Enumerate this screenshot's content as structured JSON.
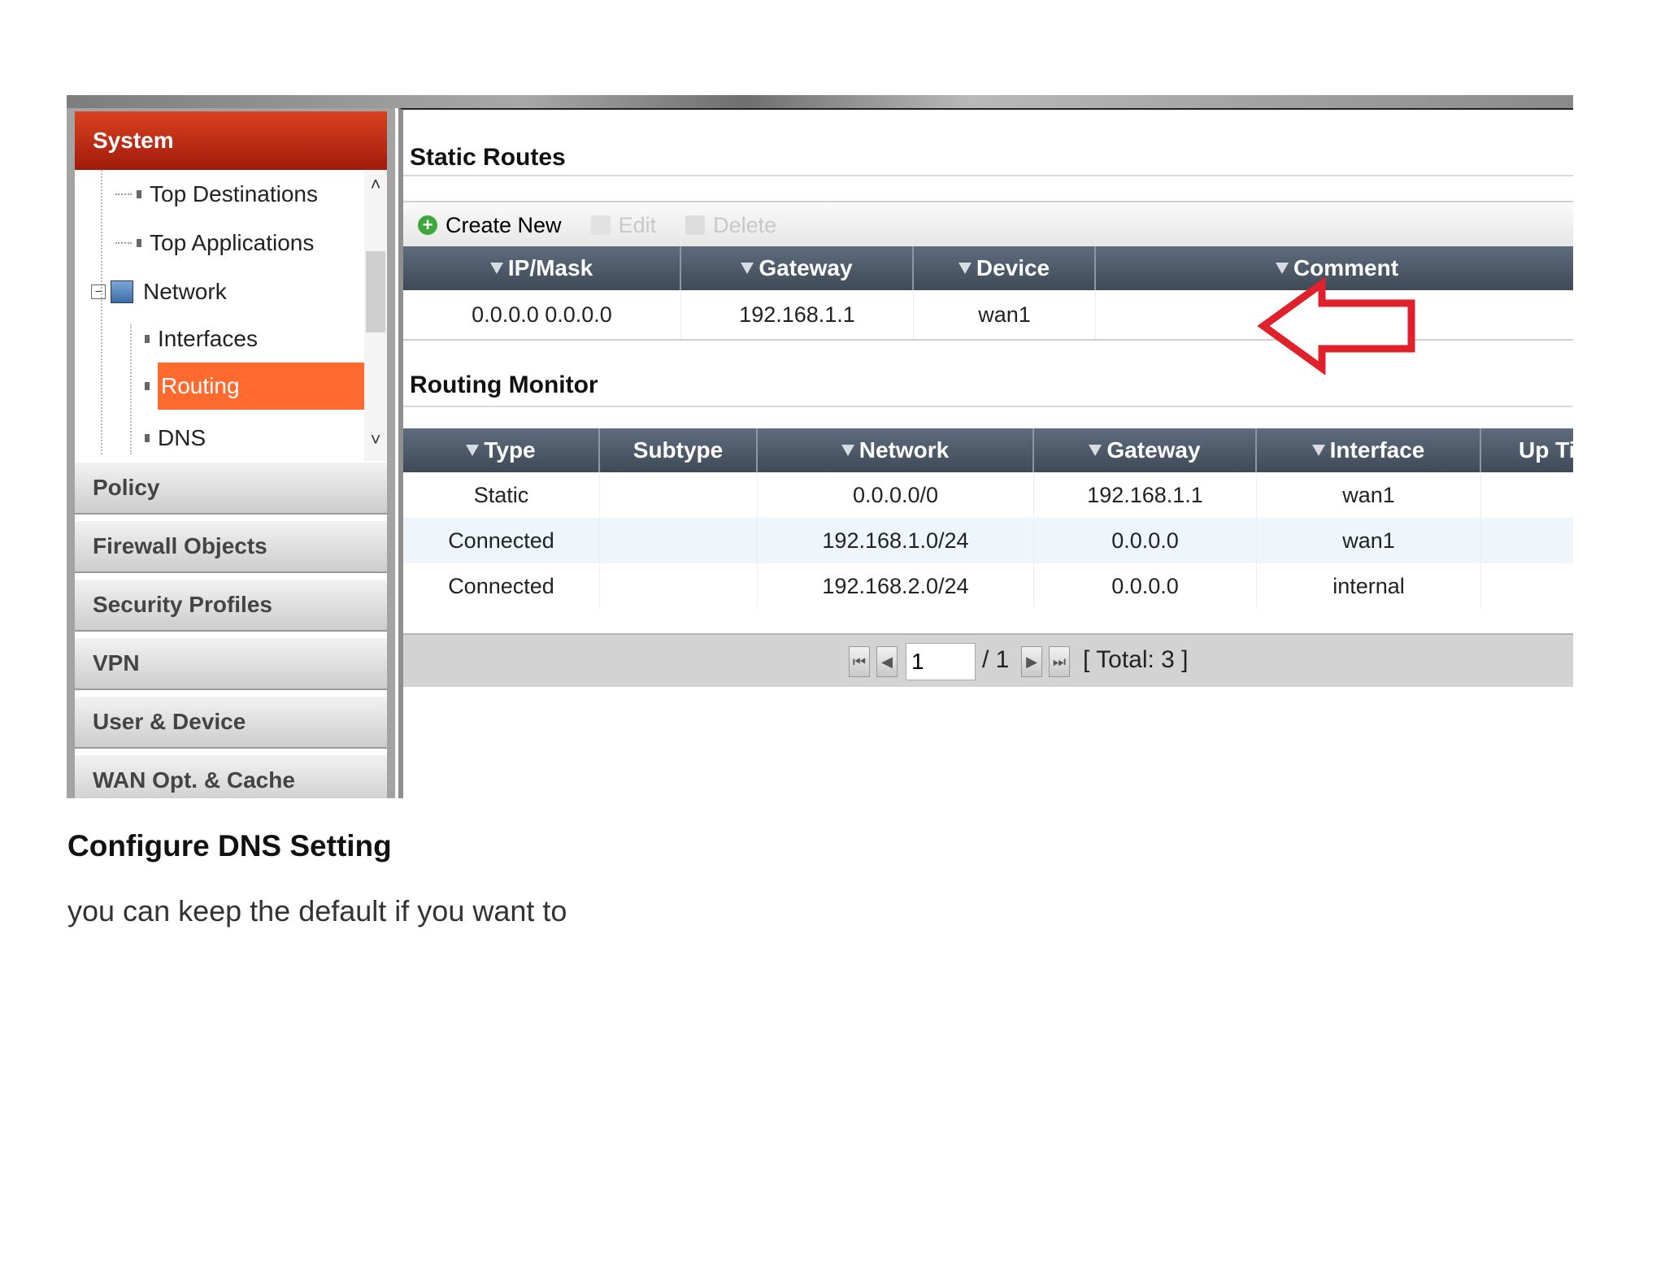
{
  "sidebar": {
    "system_label": "System",
    "tree": {
      "top_destinations": "Top Destinations",
      "top_applications": "Top Applications",
      "network": "Network",
      "interfaces": "Interfaces",
      "routing": "Routing",
      "dns": "DNS"
    },
    "categories": [
      "Policy",
      "Firewall Objects",
      "Security Profiles",
      "VPN",
      "User & Device",
      "WAN Opt. & Cache"
    ]
  },
  "static_routes": {
    "title": "Static Routes",
    "toolbar": {
      "create_new": "Create New",
      "edit": "Edit",
      "delete": "Delete"
    },
    "columns": [
      "IP/Mask",
      "Gateway",
      "Device",
      "Comment"
    ],
    "rows": [
      {
        "ip_mask": "0.0.0.0 0.0.0.0",
        "gateway": "192.168.1.1",
        "device": "wan1",
        "comment": ""
      }
    ]
  },
  "routing_monitor": {
    "title": "Routing Monitor",
    "columns": [
      "Type",
      "Subtype",
      "Network",
      "Gateway",
      "Interface",
      "Up Ti"
    ],
    "rows": [
      {
        "type": "Static",
        "subtype": "",
        "network": "0.0.0.0/0",
        "gateway": "192.168.1.1",
        "interface": "wan1",
        "up_time": ""
      },
      {
        "type": "Connected",
        "subtype": "",
        "network": "192.168.1.0/24",
        "gateway": "0.0.0.0",
        "interface": "wan1",
        "up_time": ""
      },
      {
        "type": "Connected",
        "subtype": "",
        "network": "192.168.2.0/24",
        "gateway": "0.0.0.0",
        "interface": "internal",
        "up_time": ""
      }
    ],
    "pager": {
      "page": "1",
      "of_text": "/ 1",
      "total_text": "[ Total: 3 ]"
    }
  },
  "document": {
    "heading": "Configure DNS Setting",
    "body": "you can keep the default if you want to"
  },
  "colors": {
    "system_header": "#b8240f",
    "selected_item": "#ff6a2e",
    "grid_header": "#4a5565",
    "annotation_arrow": "#e0202a"
  }
}
